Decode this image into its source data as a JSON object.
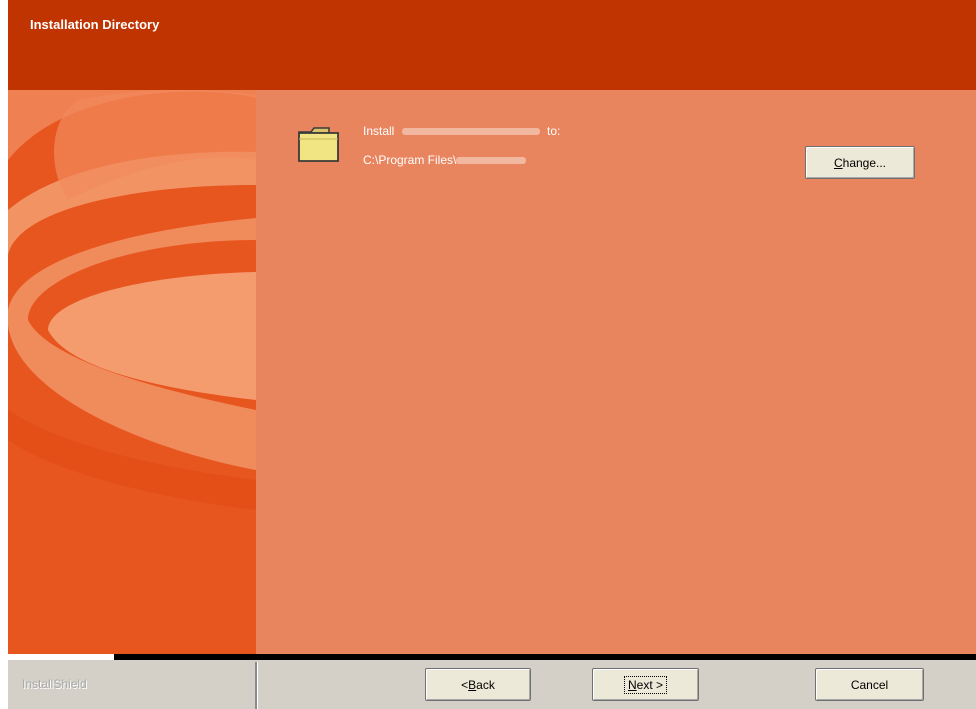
{
  "header": {
    "title": "Installation Directory"
  },
  "content": {
    "install_prefix": "Install",
    "install_suffix": "to:",
    "path_prefix": "C:\\Program Files\\",
    "change_button": {
      "label_underlined": "C",
      "label_rest": "hange..."
    }
  },
  "footer": {
    "brand": "InstallShield",
    "back_button": {
      "prefix": "< ",
      "underlined": "B",
      "rest": "ack"
    },
    "next_button": {
      "underlined": "N",
      "rest": "ext >"
    },
    "cancel_button": "Cancel"
  },
  "icons": {
    "folder": "folder-icon"
  },
  "colors": {
    "header": "#bf3400",
    "left_panel": "#e8561f",
    "content": "#e8845e",
    "button_face": "#ece9d8"
  }
}
